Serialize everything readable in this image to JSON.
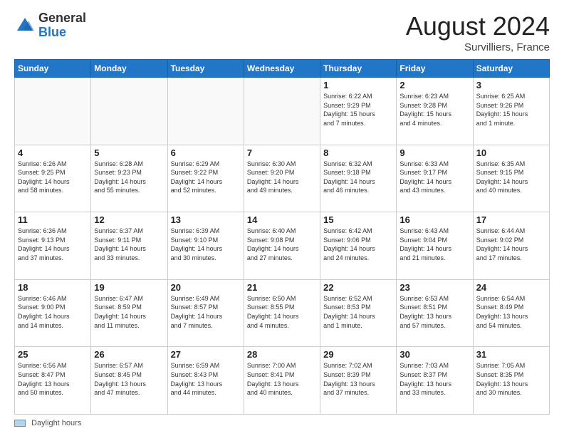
{
  "header": {
    "logo_general": "General",
    "logo_blue": "Blue",
    "month_title": "August 2024",
    "location": "Survilliers, France"
  },
  "footer": {
    "legend_label": "Daylight hours"
  },
  "days_of_week": [
    "Sunday",
    "Monday",
    "Tuesday",
    "Wednesday",
    "Thursday",
    "Friday",
    "Saturday"
  ],
  "weeks": [
    [
      {
        "day": "",
        "info": ""
      },
      {
        "day": "",
        "info": ""
      },
      {
        "day": "",
        "info": ""
      },
      {
        "day": "",
        "info": ""
      },
      {
        "day": "1",
        "info": "Sunrise: 6:22 AM\nSunset: 9:29 PM\nDaylight: 15 hours\nand 7 minutes."
      },
      {
        "day": "2",
        "info": "Sunrise: 6:23 AM\nSunset: 9:28 PM\nDaylight: 15 hours\nand 4 minutes."
      },
      {
        "day": "3",
        "info": "Sunrise: 6:25 AM\nSunset: 9:26 PM\nDaylight: 15 hours\nand 1 minute."
      }
    ],
    [
      {
        "day": "4",
        "info": "Sunrise: 6:26 AM\nSunset: 9:25 PM\nDaylight: 14 hours\nand 58 minutes."
      },
      {
        "day": "5",
        "info": "Sunrise: 6:28 AM\nSunset: 9:23 PM\nDaylight: 14 hours\nand 55 minutes."
      },
      {
        "day": "6",
        "info": "Sunrise: 6:29 AM\nSunset: 9:22 PM\nDaylight: 14 hours\nand 52 minutes."
      },
      {
        "day": "7",
        "info": "Sunrise: 6:30 AM\nSunset: 9:20 PM\nDaylight: 14 hours\nand 49 minutes."
      },
      {
        "day": "8",
        "info": "Sunrise: 6:32 AM\nSunset: 9:18 PM\nDaylight: 14 hours\nand 46 minutes."
      },
      {
        "day": "9",
        "info": "Sunrise: 6:33 AM\nSunset: 9:17 PM\nDaylight: 14 hours\nand 43 minutes."
      },
      {
        "day": "10",
        "info": "Sunrise: 6:35 AM\nSunset: 9:15 PM\nDaylight: 14 hours\nand 40 minutes."
      }
    ],
    [
      {
        "day": "11",
        "info": "Sunrise: 6:36 AM\nSunset: 9:13 PM\nDaylight: 14 hours\nand 37 minutes."
      },
      {
        "day": "12",
        "info": "Sunrise: 6:37 AM\nSunset: 9:11 PM\nDaylight: 14 hours\nand 33 minutes."
      },
      {
        "day": "13",
        "info": "Sunrise: 6:39 AM\nSunset: 9:10 PM\nDaylight: 14 hours\nand 30 minutes."
      },
      {
        "day": "14",
        "info": "Sunrise: 6:40 AM\nSunset: 9:08 PM\nDaylight: 14 hours\nand 27 minutes."
      },
      {
        "day": "15",
        "info": "Sunrise: 6:42 AM\nSunset: 9:06 PM\nDaylight: 14 hours\nand 24 minutes."
      },
      {
        "day": "16",
        "info": "Sunrise: 6:43 AM\nSunset: 9:04 PM\nDaylight: 14 hours\nand 21 minutes."
      },
      {
        "day": "17",
        "info": "Sunrise: 6:44 AM\nSunset: 9:02 PM\nDaylight: 14 hours\nand 17 minutes."
      }
    ],
    [
      {
        "day": "18",
        "info": "Sunrise: 6:46 AM\nSunset: 9:00 PM\nDaylight: 14 hours\nand 14 minutes."
      },
      {
        "day": "19",
        "info": "Sunrise: 6:47 AM\nSunset: 8:59 PM\nDaylight: 14 hours\nand 11 minutes."
      },
      {
        "day": "20",
        "info": "Sunrise: 6:49 AM\nSunset: 8:57 PM\nDaylight: 14 hours\nand 7 minutes."
      },
      {
        "day": "21",
        "info": "Sunrise: 6:50 AM\nSunset: 8:55 PM\nDaylight: 14 hours\nand 4 minutes."
      },
      {
        "day": "22",
        "info": "Sunrise: 6:52 AM\nSunset: 8:53 PM\nDaylight: 14 hours\nand 1 minute."
      },
      {
        "day": "23",
        "info": "Sunrise: 6:53 AM\nSunset: 8:51 PM\nDaylight: 13 hours\nand 57 minutes."
      },
      {
        "day": "24",
        "info": "Sunrise: 6:54 AM\nSunset: 8:49 PM\nDaylight: 13 hours\nand 54 minutes."
      }
    ],
    [
      {
        "day": "25",
        "info": "Sunrise: 6:56 AM\nSunset: 8:47 PM\nDaylight: 13 hours\nand 50 minutes."
      },
      {
        "day": "26",
        "info": "Sunrise: 6:57 AM\nSunset: 8:45 PM\nDaylight: 13 hours\nand 47 minutes."
      },
      {
        "day": "27",
        "info": "Sunrise: 6:59 AM\nSunset: 8:43 PM\nDaylight: 13 hours\nand 44 minutes."
      },
      {
        "day": "28",
        "info": "Sunrise: 7:00 AM\nSunset: 8:41 PM\nDaylight: 13 hours\nand 40 minutes."
      },
      {
        "day": "29",
        "info": "Sunrise: 7:02 AM\nSunset: 8:39 PM\nDaylight: 13 hours\nand 37 minutes."
      },
      {
        "day": "30",
        "info": "Sunrise: 7:03 AM\nSunset: 8:37 PM\nDaylight: 13 hours\nand 33 minutes."
      },
      {
        "day": "31",
        "info": "Sunrise: 7:05 AM\nSunset: 8:35 PM\nDaylight: 13 hours\nand 30 minutes."
      }
    ]
  ]
}
